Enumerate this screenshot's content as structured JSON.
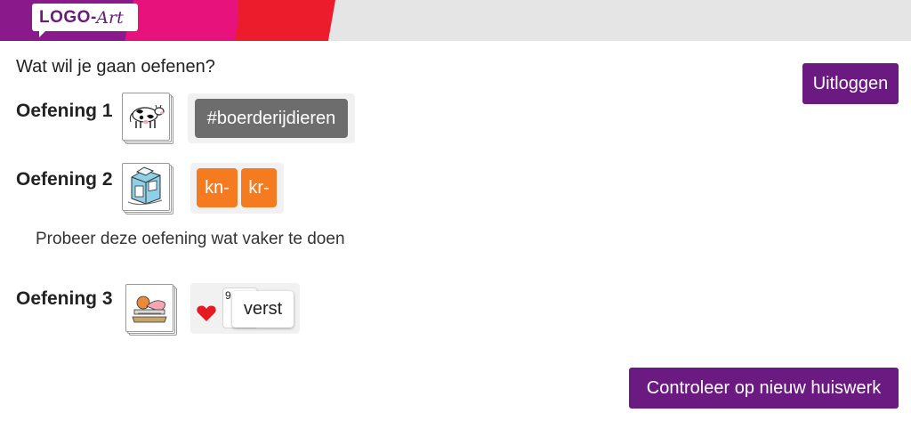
{
  "header": {
    "logo_main": "LOGO",
    "logo_dash": "-",
    "logo_art": "Art"
  },
  "main": {
    "question": "Wat wil je gaan oefenen?",
    "logout_label": "Uitloggen",
    "check_homework_label": "Controleer op nieuw huiswerk",
    "advice": "Probeer deze oefening wat vaker te doen"
  },
  "exercises": [
    {
      "label": "Oefening 1",
      "image": "cow-icon",
      "tags": [
        "#boerderijdieren"
      ]
    },
    {
      "label": "Oefening 2",
      "image": "milk-carton-icon",
      "tags": [
        "kn-",
        "kr-"
      ]
    },
    {
      "label": "Oefening 3",
      "image": "person-lying-icon",
      "card_count": "9",
      "card_word": "verst",
      "card_icon": "heart-icon"
    }
  ],
  "colors": {
    "brand_purple": "#6a1a80",
    "tag_grey": "#6d6d6d",
    "tag_orange": "#f47b20",
    "heart_red": "#e41b23"
  }
}
